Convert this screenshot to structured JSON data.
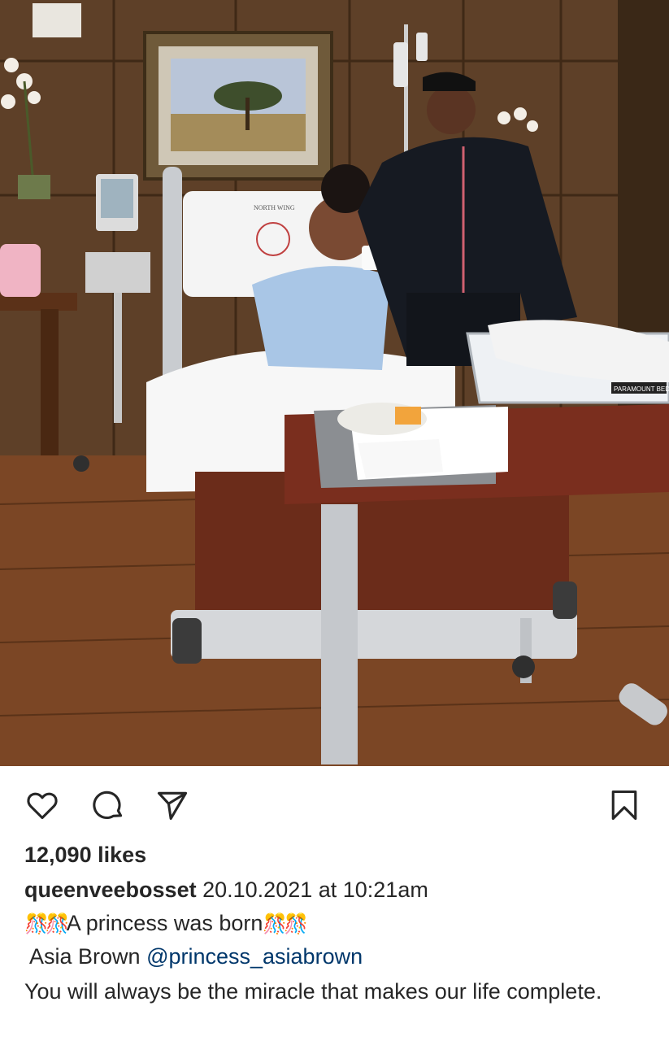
{
  "post": {
    "likes_text": "12,090 likes",
    "username": "queenveebosset",
    "timestamp": "20.10.2021 at 10:21am",
    "caption_line1": "A princess was born",
    "caption_line2_prefix": "Asia Brown ",
    "caption_mention": "@princess_asiabrown",
    "caption_line3": "You will always be the miracle that makes our life complete.",
    "confetti_glyph": "🎊🎊"
  },
  "photo": {
    "pillow_text": "NORTH WING",
    "bed_label": "PARAMOUNT BED"
  },
  "icons": {
    "like": "heart-icon",
    "comment": "comment-icon",
    "share": "share-icon",
    "save": "bookmark-icon"
  }
}
